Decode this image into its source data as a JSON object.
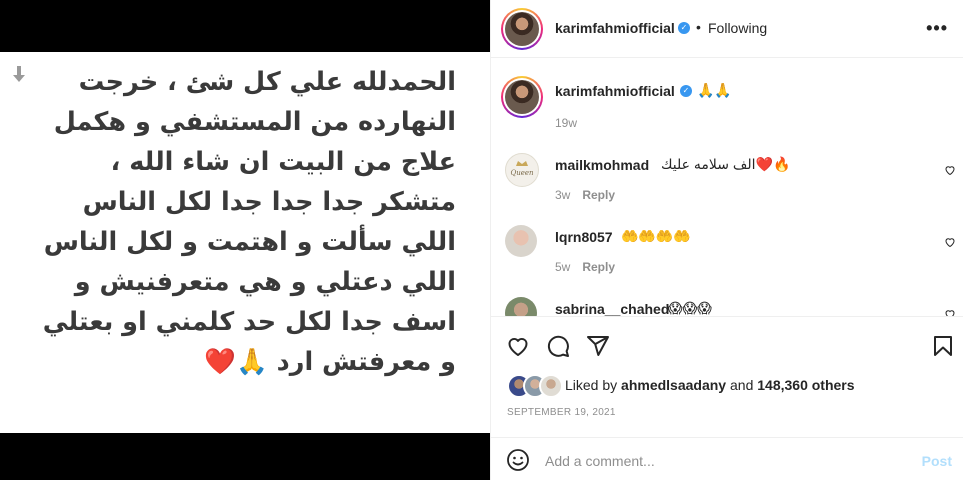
{
  "note": {
    "lines": [
      "الحمدلله علي كل شئ ، خرجت",
      "النهارده من المستشفي و هكمل",
      "علاج من البيت ان شاء الله ،",
      "متشكر جدا جدا جدا لكل الناس",
      "اللي سألت و اهتمت و لكل الناس",
      "اللي دعتلي و هي متعرفنيش و",
      "اسف جدا لكل حد كلمني او بعتلي",
      "و معرفتش ارد 🙏❤️"
    ]
  },
  "header": {
    "username": "karimfahmiofficial",
    "separator": "•",
    "follow_status": "Following",
    "more_label": "•••"
  },
  "caption": {
    "username": "karimfahmiofficial",
    "text": "🙏🙏",
    "time": "19w"
  },
  "comments": [
    {
      "username": "mailkmohmad",
      "text": "الف سلامه عليك❤️🔥",
      "time": "3w",
      "reply": "Reply"
    },
    {
      "username": "lqrn8057",
      "text": "🤲🤲🤲🤲",
      "time": "5w",
      "reply": "Reply"
    },
    {
      "username": "sabrina__chahed",
      "text": "😱😱😱",
      "time": "",
      "reply": ""
    }
  ],
  "likes": {
    "prefix": "Liked by ",
    "user": "ahmedlsaadany",
    "middle": " and ",
    "count": "148,360 others"
  },
  "date": "SEPTEMBER 19, 2021",
  "comment_box": {
    "placeholder": "Add a comment...",
    "post_label": "Post"
  },
  "colors": {
    "verified": "#3897f0",
    "post_disabled": "#b2dffc",
    "meta_gray": "#8e8e8e"
  }
}
